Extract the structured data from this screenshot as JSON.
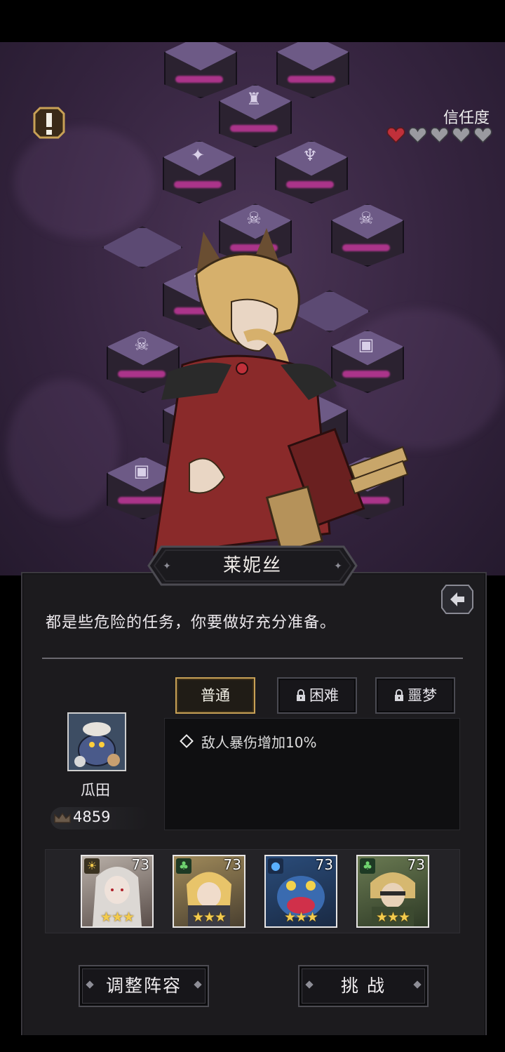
{
  "hud": {
    "trust_label": "信任度",
    "trust_filled": 1,
    "trust_total": 5
  },
  "npc": {
    "name": "莱妮丝",
    "dialog": "都是些危险的任务，你要做好充分准备。"
  },
  "difficulty": [
    {
      "label": "普通",
      "selected": true,
      "locked": false
    },
    {
      "label": "困难",
      "selected": false,
      "locked": true
    },
    {
      "label": "噩梦",
      "selected": false,
      "locked": true
    }
  ],
  "effects": [
    "敌人暴伤增加10%"
  ],
  "enemy": {
    "name": "瓜田",
    "power": "4859"
  },
  "team": [
    {
      "level": "73",
      "stars": "★★★",
      "element": "sun"
    },
    {
      "level": "73",
      "stars": "★★★",
      "element": "leaf"
    },
    {
      "level": "73",
      "stars": "★★★",
      "element": "water"
    },
    {
      "level": "73",
      "stars": "★★★",
      "element": "leaf"
    }
  ],
  "buttons": {
    "adjust": "调整阵容",
    "challenge": "挑 战"
  },
  "colors": {
    "accent_gold": "#c8a156",
    "trust_red": "#c0303a",
    "glow_pink": "#d63aa8",
    "star": "#f3cb4d"
  }
}
